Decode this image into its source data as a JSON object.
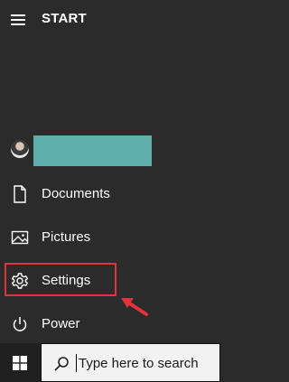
{
  "header": {
    "title": "START",
    "menu_icon": "hamburger-menu-icon"
  },
  "user": {
    "avatar_icon": "user-avatar",
    "name_redaction_color": "#5eb0ad"
  },
  "menu": {
    "items": [
      {
        "label": "Documents",
        "icon": "document-icon"
      },
      {
        "label": "Pictures",
        "icon": "picture-icon"
      },
      {
        "label": "Settings",
        "icon": "gear-icon"
      },
      {
        "label": "Power",
        "icon": "power-icon"
      }
    ]
  },
  "annotation": {
    "highlight_color": "#e0343c",
    "arrow_color": "#e0343c",
    "target": "Settings"
  },
  "taskbar": {
    "windows_icon": "windows-logo-icon",
    "search": {
      "placeholder": "Type here to search",
      "icon": "search-icon"
    }
  }
}
